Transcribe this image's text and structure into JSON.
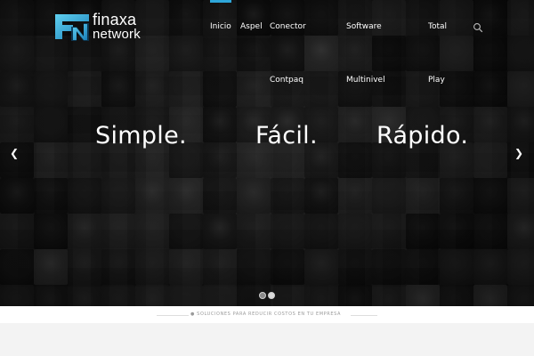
{
  "brand": {
    "name_line1": "finaxa",
    "name_line2": "network",
    "accent_color": "#2ea6d9",
    "logo_icon": "fn-monogram-icon"
  },
  "nav": {
    "items": [
      {
        "label": "Inicio"
      },
      {
        "label": "Aspel"
      },
      {
        "label": "Conector"
      },
      {
        "label": "Contpaq"
      },
      {
        "label": "Software"
      },
      {
        "label": "Multinivel"
      },
      {
        "label": "Total"
      },
      {
        "label": "Play"
      }
    ],
    "search_icon": "search-icon"
  },
  "slider": {
    "slogans": [
      "Simple.",
      "Fácil.",
      "Rápido."
    ],
    "prev_icon": "chevron-left-icon",
    "next_icon": "chevron-right-icon",
    "slides_total": 2,
    "active_slide": 1
  },
  "tagline": {
    "icon": "lightbulb-icon",
    "text": "SOLUCIONES PARA REDUCIR COSTOS EN TU EMPRESA"
  }
}
